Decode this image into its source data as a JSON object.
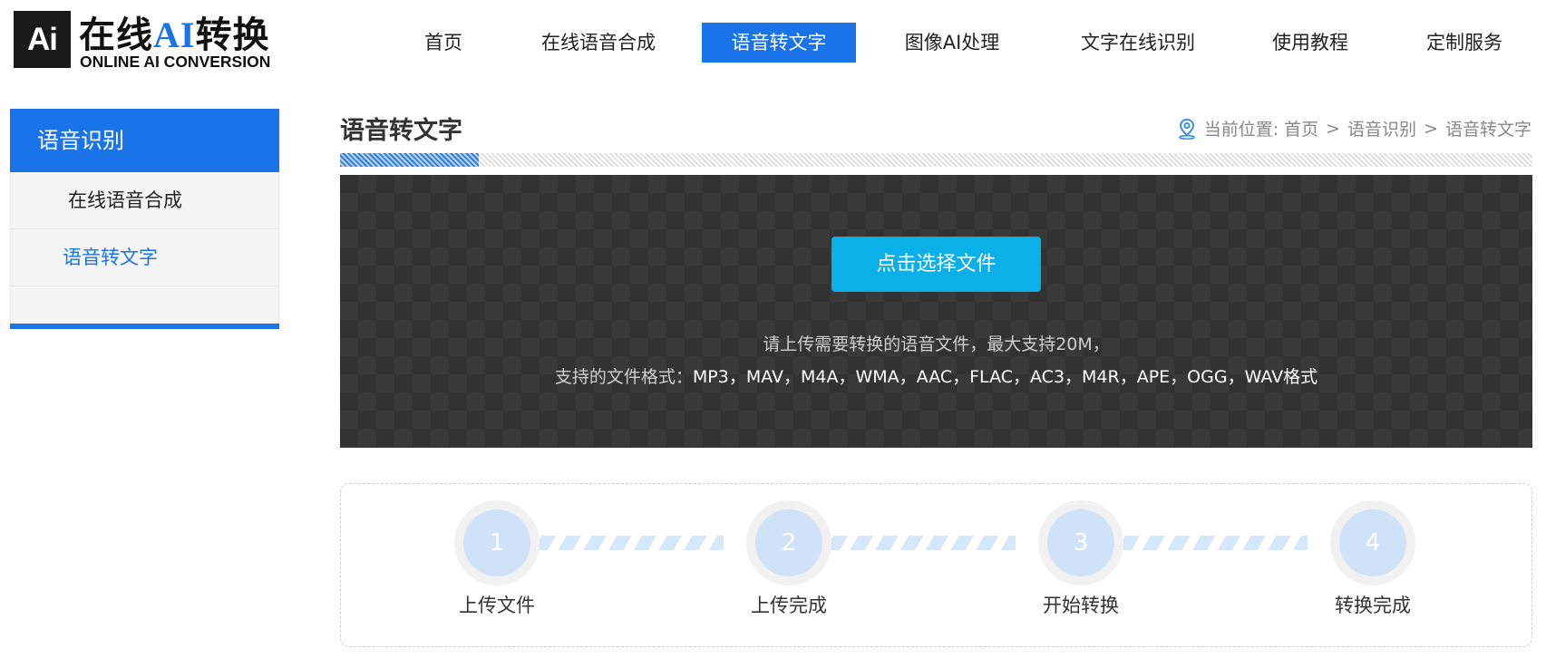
{
  "logo": {
    "badge": "Ai",
    "cn_prefix": "在线",
    "cn_ai": "AI",
    "cn_suffix": "转换",
    "en": "ONLINE AI CONVERSION"
  },
  "nav": {
    "items": [
      {
        "label": "首页"
      },
      {
        "label": "在线语音合成"
      },
      {
        "label": "语音转文字",
        "active": true
      },
      {
        "label": "图像AI处理"
      },
      {
        "label": "文字在线识别"
      },
      {
        "label": "使用教程"
      },
      {
        "label": "定制服务"
      }
    ]
  },
  "sidebar": {
    "title": "语音识别",
    "items": [
      {
        "label": "在线语音合成"
      },
      {
        "label": "语音转文字",
        "active": true
      }
    ]
  },
  "main": {
    "title": "语音转文字",
    "breadcrumb": {
      "prefix": "当前位置:",
      "items": [
        "首页",
        "语音识别",
        "语音转文字"
      ],
      "separator": ">"
    }
  },
  "upload": {
    "button_label": "点击选择文件",
    "hint_line1": "请上传需要转换的语音文件，最大支持20M，",
    "hint_line2_prefix": "支持的文件格式：",
    "hint_line2_formats": "MP3，MAV，M4A，WMA，AAC，FLAC，AC3，M4R，APE，OGG，WAV格式"
  },
  "steps": [
    {
      "number": "1",
      "label": "上传文件"
    },
    {
      "number": "2",
      "label": "上传完成"
    },
    {
      "number": "3",
      "label": "开始转换"
    },
    {
      "number": "4",
      "label": "转换完成"
    }
  ],
  "colors": {
    "accent": "#1a73e8",
    "upload_button": "#0bb0e8",
    "upload_bg": "#323232",
    "step_circle": "#cfe2f8"
  },
  "icons": {
    "breadcrumb": "location-pin-icon"
  }
}
